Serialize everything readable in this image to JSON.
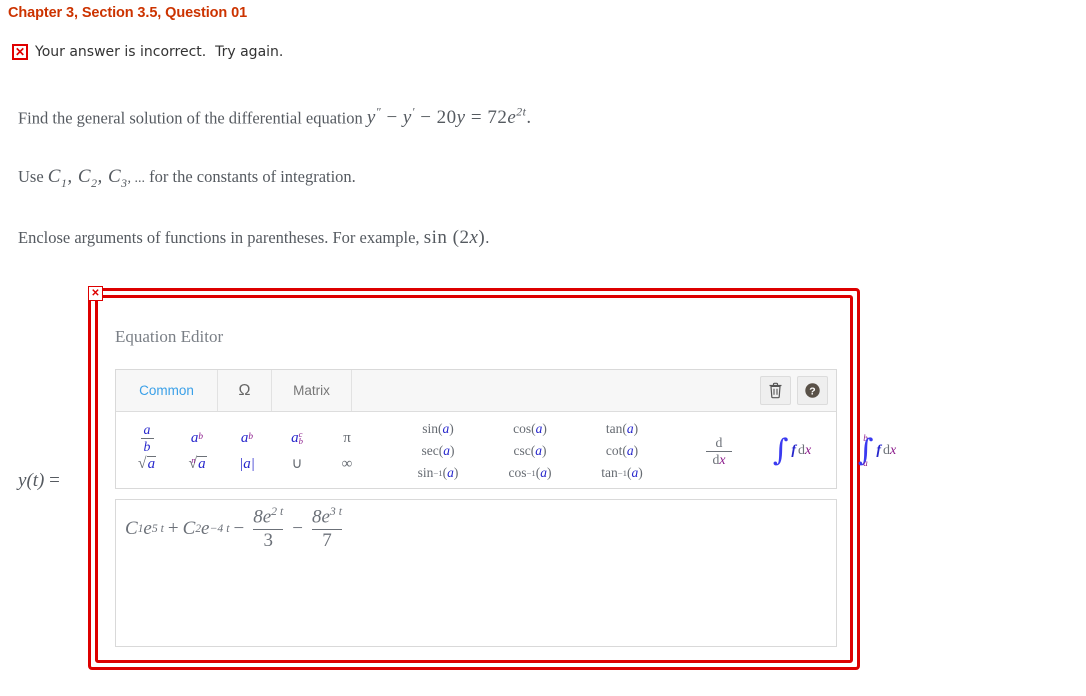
{
  "header": {
    "chapter_title": "Chapter 3, Section 3.5, Question 01",
    "feedback_icon": "x-mark-icon",
    "feedback_text": "Your answer is incorrect.  Try again."
  },
  "problem": {
    "line1_prefix": "Find the general solution of the differential equation",
    "equation": {
      "lhs_y2": "y",
      "lhs_prime2": "″",
      "minus": "−",
      "lhs_y1": "y",
      "lhs_prime1": "′",
      "coef": "20",
      "yvar": "y",
      "equals": "=",
      "rhs_coef": "72",
      "rhs_e": "e",
      "rhs_exp": "2t",
      "period": "."
    },
    "line2_prefix": "Use",
    "constants": [
      "C",
      "C",
      "C"
    ],
    "constant_subs": [
      "1",
      "2",
      "3"
    ],
    "ellipsis": ", ...",
    "line2_suffix": "for the constants of integration.",
    "line3_prefix": "Enclose arguments of functions in parentheses. For example,",
    "example_fn": "sin",
    "example_arg_open": "(",
    "example_arg_num": "2",
    "example_arg_var": "x",
    "example_arg_close": ")",
    "line3_suffix": "."
  },
  "editor": {
    "close_label": "✕",
    "title": "Equation Editor",
    "tabs": [
      {
        "label": "Common",
        "name": "tab-common",
        "active": true
      },
      {
        "label": "Ω",
        "name": "tab-omega",
        "active": false
      },
      {
        "label": "Matrix",
        "name": "tab-matrix",
        "active": false
      }
    ],
    "tool_buttons": [
      {
        "name": "trash-icon",
        "label": "Delete"
      },
      {
        "name": "help-icon",
        "label": "Help"
      }
    ],
    "palette": {
      "group1": {
        "row1": [
          {
            "name": "fraction-button",
            "type": "fraction",
            "num": "a",
            "den": "b"
          },
          {
            "name": "superscript-button",
            "type": "sup",
            "base": "a",
            "sup": "b"
          },
          {
            "name": "subscript-button",
            "type": "sub",
            "base": "a",
            "sub": "b"
          },
          {
            "name": "sub-sup-button",
            "type": "subsup",
            "base": "a",
            "sub": "b",
            "sup": "c"
          },
          {
            "name": "pi-button",
            "type": "plain",
            "glyph": "π"
          }
        ],
        "row2": [
          {
            "name": "square-root-button",
            "type": "sqrt",
            "radicand": "a"
          },
          {
            "name": "nth-root-button",
            "type": "nthroot",
            "index": "n",
            "radicand": "a"
          },
          {
            "name": "absolute-value-button",
            "type": "abs",
            "arg": "a"
          },
          {
            "name": "union-button",
            "type": "plain",
            "glyph": "∪"
          },
          {
            "name": "infinity-button",
            "type": "plain",
            "glyph": "∞"
          }
        ]
      },
      "group2": {
        "row1": [
          {
            "name": "sin-button",
            "fn": "sin",
            "arg": "a"
          },
          {
            "name": "cos-button",
            "fn": "cos",
            "arg": "a"
          },
          {
            "name": "tan-button",
            "fn": "tan",
            "arg": "a"
          }
        ],
        "row2": [
          {
            "name": "sec-button",
            "fn": "sec",
            "arg": "a"
          },
          {
            "name": "csc-button",
            "fn": "csc",
            "arg": "a"
          },
          {
            "name": "cot-button",
            "fn": "cot",
            "arg": "a"
          }
        ],
        "row3": [
          {
            "name": "arcsin-button",
            "fn": "sin",
            "inv": "−1",
            "arg": "a"
          },
          {
            "name": "arccos-button",
            "fn": "cos",
            "inv": "−1",
            "arg": "a"
          },
          {
            "name": "arctan-button",
            "fn": "tan",
            "inv": "−1",
            "arg": "a"
          }
        ]
      },
      "group3": [
        {
          "name": "derivative-button",
          "type": "ddx",
          "num": "d",
          "den_d": "d",
          "den_x": "x"
        },
        {
          "name": "indefinite-integral-button",
          "type": "integral",
          "sym": "∫",
          "f": "f",
          "d": "d",
          "x": "x"
        },
        {
          "name": "definite-integral-button",
          "type": "definite-integral",
          "sym": "∫",
          "upper": "b",
          "lower": "a",
          "f": "f",
          "d": "d",
          "x": "x"
        }
      ]
    }
  },
  "answer": {
    "label_y": "y",
    "label_paren_open": "(",
    "label_var": "t",
    "label_paren_close": ")",
    "label_equals": "=",
    "expression": {
      "term1_c": "C",
      "term1_sub": "1",
      "term1_e": "e",
      "term1_exp": "5 t",
      "plus": "+",
      "term2_c": "C",
      "term2_sub": "2",
      "term2_e": "e",
      "term2_exp": "−4 t",
      "minus1": "−",
      "term3_num_coef": "8",
      "term3_num_e": "e",
      "term3_num_exp": "2 t",
      "term3_den": "3",
      "minus2": "−",
      "term4_num_coef": "8",
      "term4_num_e": "e",
      "term4_num_exp": "3 t",
      "term4_den": "7"
    }
  },
  "colors": {
    "chapter_title": "#cc3300",
    "error_red": "#e00000",
    "frame_red": "#dd0000",
    "active_tab_blue": "#3aa0e8",
    "math_gray": "#555a60",
    "symbol_blue": "#2727cc",
    "symbol_magenta": "#8b1a8b"
  }
}
